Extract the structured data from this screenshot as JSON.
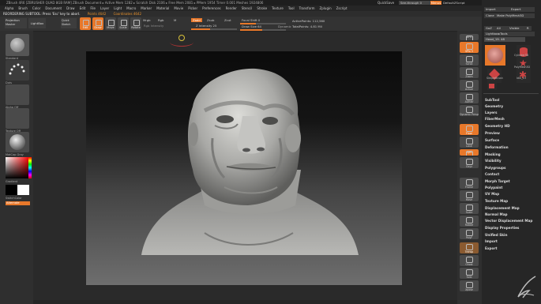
{
  "title_bar": {
    "text": "ZBrush 4R6 [ZBRUSHER QUAD 8GB RAM]   ZBrush Document   ▸ Active Mem 1282 ▸ Scratch Disk 2106 ▸ Free Mem 2081 ▸ PMem 1954 Timer 0.001 Meshes 1924806",
    "quicksave": "QuickSave",
    "see_through": "See-through 0",
    "menus": "Menus",
    "default_script": "DefaultZScript"
  },
  "menu_bar": {
    "items": [
      "Alpha",
      "Brush",
      "Color",
      "Document",
      "Draw",
      "Edit",
      "File",
      "Layer",
      "Light",
      "Macro",
      "Marker",
      "Material",
      "Movie",
      "Picker",
      "Preferences",
      "Render",
      "Stencil",
      "Stroke",
      "Texture",
      "Tool",
      "Transform",
      "Zplugin",
      "Zscript"
    ]
  },
  "note_bar": {
    "warning": "REORDERING SUBTOOL: Press 'Esc' key to abort.",
    "points": "Points 4642",
    "coords": "Coordinates 4642"
  },
  "toolbar": {
    "projection_master": "Projection Master",
    "lightbox": "LightBox",
    "quick_sketch": "Quick Sketch",
    "edit": "Edit",
    "draw": "Draw",
    "move": "Move",
    "scale": "Scale",
    "rotate": "Rotate",
    "mrgb": "Mrgb",
    "rgb": "Rgb",
    "m": "M",
    "zadd": "Zadd",
    "zsub": "Zsub",
    "zcut": "Zcut",
    "rgb_intensity": "Rgb Intensity",
    "z_intensity": "Z Intensity 25",
    "focal_shift": "Focal Shift 0",
    "draw_size": "Draw Size 64",
    "dynamic": "Dynamic",
    "active_points": "ActivePoints: 112,560",
    "total_points": "TotalPoints: 4.81 Mil"
  },
  "left_shelf": {
    "labels": [
      "Standard",
      "Dots",
      "Alpha Off",
      "Texture Off",
      "MatCap Gray"
    ],
    "gradient": "Gradient",
    "switch_color": "SwitchColor",
    "alternate": "Alternate"
  },
  "right_shelf": {
    "buttons": [
      "BPR",
      "SPix 3",
      "Scroll",
      "Zoom",
      "Actual",
      "AAHalf",
      "Dynamic Persp",
      "Floor",
      "Local",
      "Sym",
      "Gxyz",
      "Frame",
      "Move",
      "Scale",
      "Rotate",
      "PolyF",
      "Transp",
      "Ghost",
      "Solo",
      "Xpose"
    ]
  },
  "tool_panel": {
    "row1": [
      "Import",
      "Export"
    ],
    "row2": [
      "Clone",
      "Make PolyMesh3D"
    ],
    "row3": [
      "GoZ",
      "All",
      "Visible",
      "R"
    ],
    "lightbox_tools": "Lightbox▸Tools",
    "tool_label": "Head_19. 48",
    "thumbs": [
      "Head_19",
      "Cylinder3D",
      "PolyMesh3D",
      "SimpleBrush",
      "Idle_19"
    ],
    "menu": [
      "SubTool",
      "Geometry",
      "Layers",
      "FiberMesh",
      "Geometry HD",
      "Preview",
      "Surface",
      "Deformation",
      "Masking",
      "Visibility",
      "Polygroups",
      "Contact",
      "Morph Target",
      "Polypaint",
      "UV Map",
      "Texture Map",
      "Displacement Map",
      "Normal Map",
      "Vector Displacement Map",
      "Display Properties",
      "Unified Skin",
      "Import",
      "Export"
    ]
  },
  "colors": {
    "accent": "#e8782a",
    "panel": "#2f2f2f",
    "button": "#4a4a4a"
  }
}
